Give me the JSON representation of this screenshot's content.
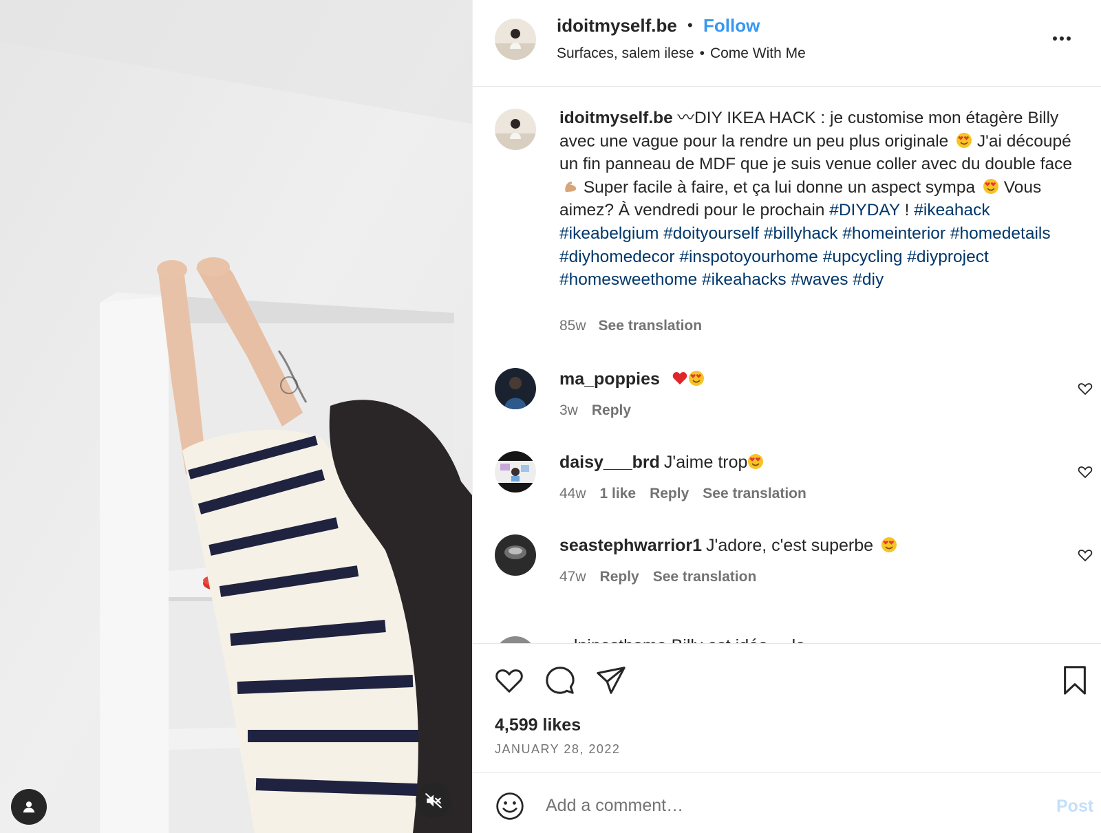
{
  "post": {
    "username": "idoitmyself.be",
    "separator": "•",
    "follow_label": "Follow",
    "audio": "Surfaces, salem ilese",
    "audio_separator": "•",
    "audio_track": "Come With Me"
  },
  "caption": {
    "username": "idoitmyself.be",
    "text_1": "〰DIY IKEA HACK : je customise mon étagère Billy avec une vague pour la rendre un peu plus originale",
    "text_2": "J'ai découpé un fin panneau de MDF que je suis venue coller avec du double face",
    "text_3": "Super facile à faire, et ça lui donne un aspect sympa",
    "text_4": "Vous aimez? À vendredi pour le prochain",
    "hashtags_1": "#DIYDAY",
    "text_5": " ! ",
    "hashtags_2": "#ikeahack #ikeabelgium #doityourself #billyhack #homeinterior #homedetails #diyhomedecor #inspotoyourhome #upcycling #diyproject #homesweethome #ikeahacks #waves #diy",
    "time": "85w",
    "see_translation": "See translation"
  },
  "comments": [
    {
      "username": "ma_poppies",
      "text": "",
      "time": "3w",
      "likes": "",
      "reply": "Reply",
      "translation": ""
    },
    {
      "username": "daisy___brd",
      "text": "J'aime trop",
      "time": "44w",
      "likes": "1 like",
      "reply": "Reply",
      "translation": "See translation"
    },
    {
      "username": "seastephwarrior1",
      "text": "J'adore, c'est superbe",
      "time": "47w",
      "reply": "Reply",
      "likes": "",
      "translation": "See translation"
    }
  ],
  "partial_comment": {
    "text": "...lpinesthome Billy est idée ... le ... "
  },
  "actions": {
    "likes": "4,599 likes",
    "date": "JANUARY 28, 2022"
  },
  "add_comment": {
    "placeholder": "Add a comment…",
    "post_label": "Post"
  },
  "icons": {
    "tag": "user-tag-icon",
    "mute": "muted-speaker-icon",
    "more": "more-options-icon",
    "like": "heart-icon",
    "comment": "comment-bubble-icon",
    "share": "paper-plane-icon",
    "save": "bookmark-icon",
    "emoji": "smiley-icon"
  },
  "colors": {
    "follow": "#3797f0",
    "hashtag": "#00376b",
    "muted_text": "#737373",
    "post_disabled": "#c2dffb"
  }
}
